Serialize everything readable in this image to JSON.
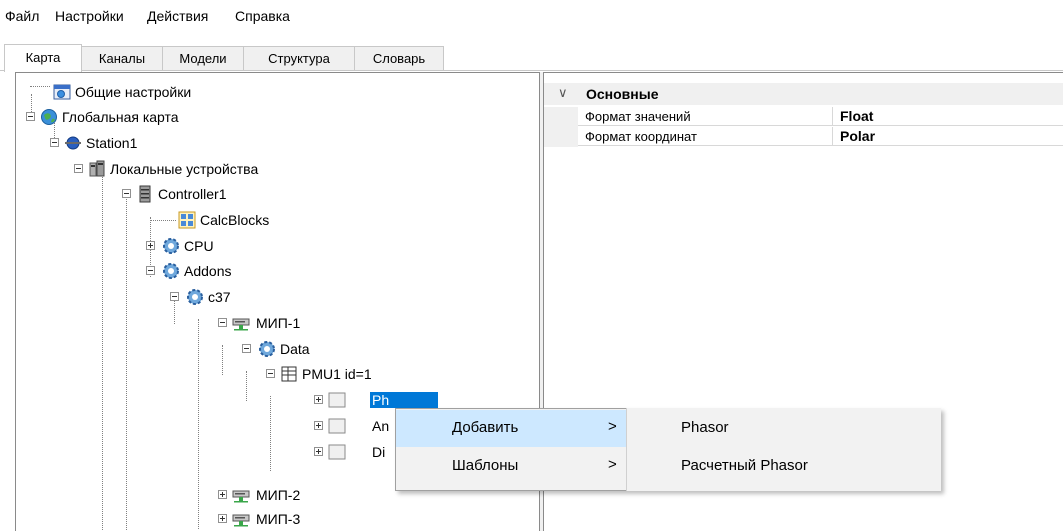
{
  "menu": [
    "Файл",
    "Настройки",
    "Действия",
    "Справка"
  ],
  "tabs": [
    "Карта",
    "Каналы",
    "Модели",
    "Структура",
    "Словарь"
  ],
  "tree": [
    {
      "label": "Общие настройки",
      "icon": "settings-window-icon"
    },
    {
      "label": "Глобальная карта",
      "icon": "globe-icon"
    },
    {
      "label": "Station1",
      "icon": "station-icon"
    },
    {
      "label": "Локальные устройства",
      "icon": "devices-icon"
    },
    {
      "label": "Controller1",
      "icon": "server-icon"
    },
    {
      "label": "CalcBlocks",
      "icon": "calcblocks-icon"
    },
    {
      "label": "CPU",
      "icon": "gear-icon"
    },
    {
      "label": "Addons",
      "icon": "gear-icon"
    },
    {
      "label": "c37",
      "icon": "gear-icon"
    },
    {
      "label": "МИП-1",
      "icon": "network-device-icon"
    },
    {
      "label": "Data",
      "icon": "gear-icon"
    },
    {
      "label": "PMU1 id=1",
      "icon": "table-icon"
    },
    {
      "label": "Ph",
      "icon": "blank-icon"
    },
    {
      "label": "An",
      "icon": "blank-icon"
    },
    {
      "label": "Di",
      "icon": "blank-icon"
    },
    {
      "label": "МИП-2",
      "icon": "network-device-icon"
    },
    {
      "label": "МИП-3",
      "icon": "network-device-icon"
    }
  ],
  "properties": {
    "section": "Основные",
    "rows": [
      {
        "name": "Формат значений",
        "value": "Float"
      },
      {
        "name": "Формат координат",
        "value": "Polar"
      }
    ]
  },
  "context_menu": {
    "items": [
      {
        "label": "Добавить",
        "arrow": ">"
      },
      {
        "label": "Шаблоны",
        "arrow": ">"
      }
    ],
    "submenu": [
      "Phasor",
      "Расчетный Phasor"
    ]
  },
  "colors": {
    "selection": "#0078d7",
    "menu_highlight": "#cde8ff"
  }
}
